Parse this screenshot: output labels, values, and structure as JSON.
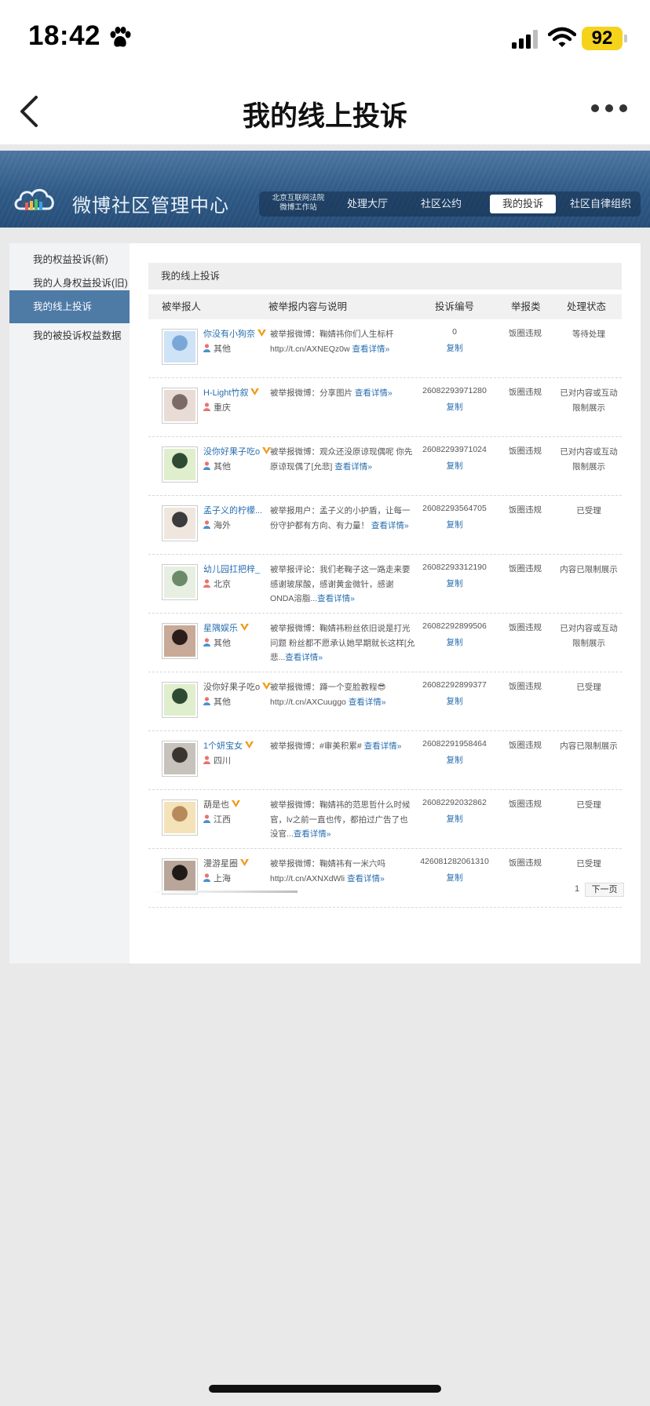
{
  "status": {
    "time": "18:42",
    "battery": "92"
  },
  "nav": {
    "title": "我的线上投诉"
  },
  "header": {
    "logo_text": "微博社区管理中心",
    "court_line1": "北京互联网法院",
    "court_line2": "微博工作站",
    "tabs": [
      "处理大厅",
      "社区公约",
      "我的投诉",
      "社区自律组织"
    ],
    "active_tab": "我的投诉"
  },
  "sidebar": {
    "items": [
      "我的权益投诉(新)",
      "我的人身权益投诉(旧)",
      "我的线上投诉",
      "我的被投诉权益数据"
    ],
    "active": "我的线上投诉"
  },
  "content": {
    "title": "我的线上投诉",
    "columns": [
      "被举报人",
      "被举报内容与说明",
      "投诉编号",
      "举报类",
      "处理状态"
    ],
    "copy_label": "复制",
    "rows": [
      {
        "user": "你没有小狗奈",
        "verified": true,
        "location": "其他",
        "desc": "被举报微博：鞠婧祎你们人生标杆 http://t.cn/AXNEQz0w ",
        "more": "查看详情»",
        "id": "0",
        "type": "饭圈违规",
        "status": "等待处理",
        "avatar_colors": [
          "#cfe3f7",
          "#7aa7d8"
        ]
      },
      {
        "user": "H-Light竹叙",
        "verified": true,
        "location": "重庆",
        "desc": "被举报微博：分享图片 ",
        "more": "查看详情»",
        "id": "26082293971280",
        "type": "饭圈违规",
        "status": "已对内容或互动限制展示",
        "avatar_colors": [
          "#e9dcd6",
          "#7b6a66"
        ]
      },
      {
        "user": "没你好果子吃o",
        "verified": true,
        "location": "其他",
        "desc": "被举报微博：观众还没原谅现偶呢 你先原谅现偶了[允悲] ",
        "more": "查看详情»",
        "id": "26082293971024",
        "type": "饭圈违规",
        "status": "已对内容或互动限制展示",
        "avatar_colors": [
          "#dfeecd",
          "#2e4a33"
        ]
      },
      {
        "user": "孟子义的柠檬...",
        "verified": false,
        "location": "海外",
        "desc": "被举报用户：孟子义的小护盾，让每一份守护都有方向、有力量！ ",
        "more": "查看详情»",
        "id": "26082293564705",
        "type": "饭圈违规",
        "status": "已受理",
        "avatar_colors": [
          "#efe6de",
          "#3b3b3b"
        ]
      },
      {
        "user": "幼儿园扛把梓_",
        "verified": false,
        "location": "北京",
        "desc": "被举报评论：我们老鞠子这一路走来要感谢玻尿酸，感谢黄金微针，感谢ONDA溶脂...",
        "more": "查看详情»",
        "id": "26082293312190",
        "type": "饭圈违规",
        "status": "内容已限制展示",
        "avatar_colors": [
          "#e7efe2",
          "#6b8a6a"
        ]
      },
      {
        "user": "星隅娱乐",
        "verified": true,
        "location": "其他",
        "desc": "被举报微博：鞠婧祎粉丝依旧说是打光问题 粉丝都不愿承认她早期就长这样[允悲...",
        "more": "查看详情»",
        "id": "26082292899506",
        "type": "饭圈违规",
        "status": "已对内容或互动限制展示",
        "avatar_colors": [
          "#c9a998",
          "#2a1d1a"
        ]
      },
      {
        "user": "没你好果子吃o",
        "verified": true,
        "location": "其他",
        "desc": "被举报微博：蹲一个变脸教程😎 http://t.cn/AXCuuggo ",
        "more": "查看详情»",
        "id": "26082292899377",
        "type": "饭圈违规",
        "status": "已受理",
        "avatar_colors": [
          "#dfeecd",
          "#2e4a33"
        ]
      },
      {
        "user": "1个妍宝女",
        "verified": true,
        "location": "四川",
        "desc": "被举报微博：#审美积累# ",
        "more": "查看详情»",
        "id": "26082291958464",
        "type": "饭圈违规",
        "status": "内容已限制展示",
        "avatar_colors": [
          "#c7c2bb",
          "#3a3531"
        ]
      },
      {
        "user": "葫是也",
        "verified": true,
        "location": "江西",
        "desc": "被举报微博：鞠婧祎的范思哲什么时候官，lv之前一直也传，都拍过广告了也没官...",
        "more": "查看详情»",
        "id": "26082292032862",
        "type": "饭圈违规",
        "status": "已受理",
        "avatar_colors": [
          "#f4e2b9",
          "#b78a5a"
        ]
      },
      {
        "user": "漫游星圈",
        "verified": true,
        "location": "上海",
        "desc": "被举报微博：鞠婧祎有一米六吗 http://t.cn/AXNXdWli ",
        "more": "查看详情»",
        "id": "426081282061310",
        "type": "饭圈违规",
        "status": "已受理",
        "avatar_colors": [
          "#b9a59a",
          "#1f1a18"
        ]
      }
    ]
  },
  "pager": {
    "page": "1",
    "next": "下一页"
  }
}
